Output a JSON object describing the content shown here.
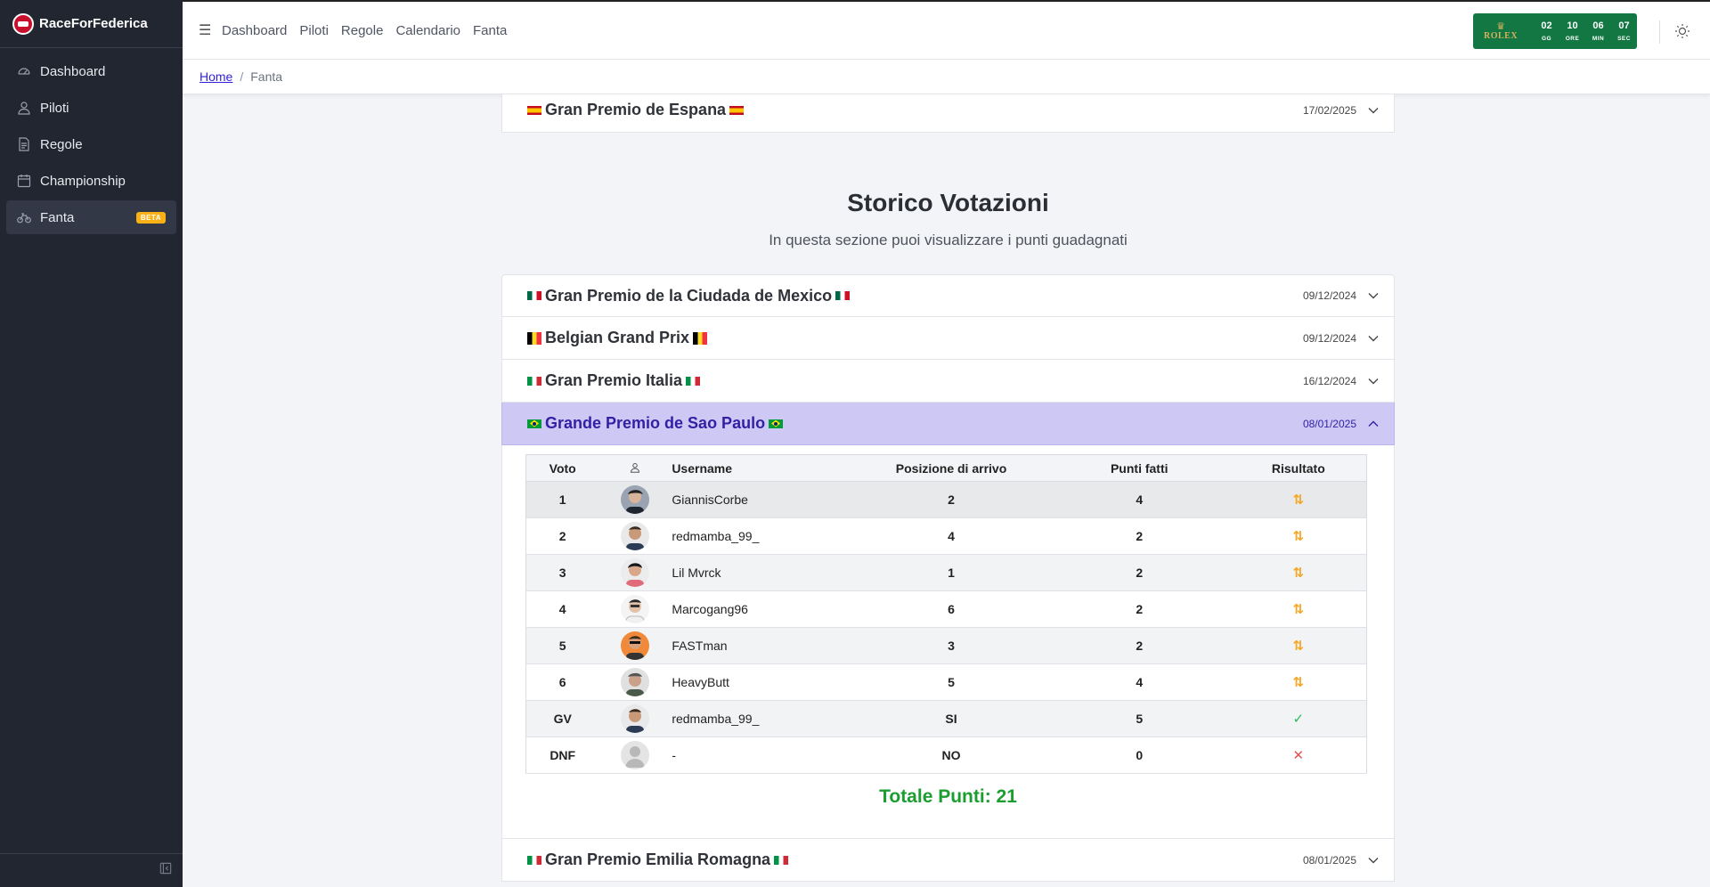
{
  "brand": {
    "name": "RaceForFederica"
  },
  "sidebar": {
    "items": [
      {
        "label": "Dashboard",
        "icon": "speedometer-icon"
      },
      {
        "label": "Piloti",
        "icon": "user-icon"
      },
      {
        "label": "Regole",
        "icon": "document-icon"
      },
      {
        "label": "Championship",
        "icon": "calendar-icon"
      },
      {
        "label": "Fanta",
        "icon": "bike-icon",
        "badge": "BETA",
        "active": true
      }
    ]
  },
  "topnav": {
    "items": [
      "Dashboard",
      "Piloti",
      "Regole",
      "Calendario",
      "Fanta"
    ]
  },
  "countdown": {
    "brand": "ROLEX",
    "days": "02",
    "days_label": "GG",
    "hours": "10",
    "hours_label": "ORE",
    "minutes": "06",
    "minutes_label": "MIN",
    "seconds": "07",
    "seconds_label": "SEC"
  },
  "breadcrumb": {
    "home": "Home",
    "separator": "/",
    "current": "Fanta"
  },
  "upcoming": {
    "title": "Gran Premio de Espana",
    "date": "17/02/2025"
  },
  "storico": {
    "title": "Storico Votazioni",
    "subtitle": "In questa sezione puoi visualizzare i punti guadagnati",
    "races": [
      {
        "title": "Gran Premio de la Ciudada de Mexico",
        "date": "09/12/2024"
      },
      {
        "title": "Belgian Grand Prix",
        "date": "09/12/2024"
      },
      {
        "title": "Gran Premio Italia",
        "date": "16/12/2024"
      },
      {
        "title": "Grande Premio de Sao Paulo",
        "date": "08/01/2025"
      },
      {
        "title": "Gran Premio Emilia Romagna",
        "date": "08/01/2025"
      }
    ]
  },
  "table": {
    "headers": [
      "Voto",
      "Username",
      "Posizione di arrivo",
      "Punti fatti",
      "Risultato"
    ],
    "rows": [
      {
        "voto": "1",
        "username": "GiannisCorbe",
        "posizione": "2",
        "punti": "4",
        "risultato": "⇅"
      },
      {
        "voto": "2",
        "username": "redmamba_99_",
        "posizione": "4",
        "punti": "2",
        "risultato": "⇅"
      },
      {
        "voto": "3",
        "username": "Lil Mvrck",
        "posizione": "1",
        "punti": "2",
        "risultato": "⇅"
      },
      {
        "voto": "4",
        "username": "Marcogang96",
        "posizione": "6",
        "punti": "2",
        "risultato": "⇅"
      },
      {
        "voto": "5",
        "username": "FASTman",
        "posizione": "3",
        "punti": "2",
        "risultato": "⇅"
      },
      {
        "voto": "6",
        "username": "HeavyButt",
        "posizione": "5",
        "punti": "4",
        "risultato": "⇅"
      },
      {
        "voto": "GV",
        "username": "redmamba_99_",
        "posizione": "SI",
        "punti": "5",
        "risultato": "✓"
      },
      {
        "voto": "DNF",
        "username": "-",
        "posizione": "NO",
        "punti": "0",
        "risultato": "✕"
      }
    ],
    "totale": "Totale Punti: 21"
  },
  "colors": {
    "sidebar_bg": "#212631",
    "accent": "#321fdb",
    "open_row": "#cdc9f4",
    "countdown_bg": "#127742",
    "total_green": "#1b9e2f",
    "arrow_orange": "#f5a623",
    "check_green": "#2eb85c",
    "cross_red": "#e55353",
    "beta_badge": "#f9b115"
  }
}
